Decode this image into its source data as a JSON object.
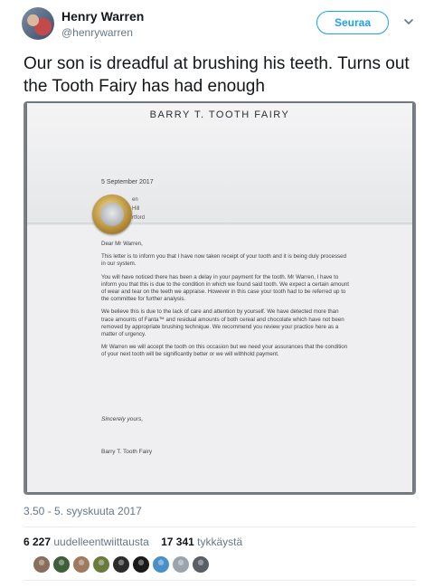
{
  "user": {
    "display_name": "Henry Warren",
    "handle": "@henrywarren"
  },
  "follow_label": "Seuraa",
  "tweet_text": "Our son is dreadful at brushing his teeth. Turns out the Tooth Fairy has had enough",
  "letter": {
    "letterhead": "BARRY T. TOOTH FAIRY",
    "date": "5 September 2017",
    "address_lines": [
      "en",
      "Hill",
      "rtford"
    ],
    "salutation": "Dear Mr Warren,",
    "paragraphs": [
      "This letter is to inform you that I have now taken receipt of your tooth and it is being duly processed in our system.",
      "You will have noticed there has been a delay in your payment for the tooth. Mr Warren, I have to inform you that this is due to the condition in which we found said tooth. We expect a certain amount of wear and tear on the teeth we appraise. However in this case your tooth had to be referred up to the committee for further analysis.",
      "We believe this is due to the lack of care and attention by yourself. We have detected more than trace amounts of Fanta™ and residual amounts of both cereal and chocolate which have not been removed by appropriate brushing technique. We recommend you review your practice here as a matter of urgency.",
      "Mr Warren we will accept the tooth on this occasion but we need your assurances that the condition of your next tooth will be significantly better or we will withhold payment."
    ],
    "closing": "Sincerely yours,",
    "signature": "Barry T. Tooth Fairy"
  },
  "timestamp": "3.50 - 5. syyskuuta 2017",
  "stats": {
    "retweets_count": "6 227",
    "retweets_label": "uudelleentwiittausta",
    "likes_count": "17 341",
    "likes_label": "tykkäystä"
  },
  "liker_avatar_colors": [
    "#8a6d5a",
    "#3f5f3a",
    "#a07a5e",
    "#6b7a3d",
    "#2b2b2b",
    "#1a1a1a",
    "#4a90c8",
    "#9aa4ad",
    "#5a5f66"
  ],
  "colors": {
    "accent": "#1da1f2",
    "text": "#14171a",
    "secondary": "#657786"
  }
}
